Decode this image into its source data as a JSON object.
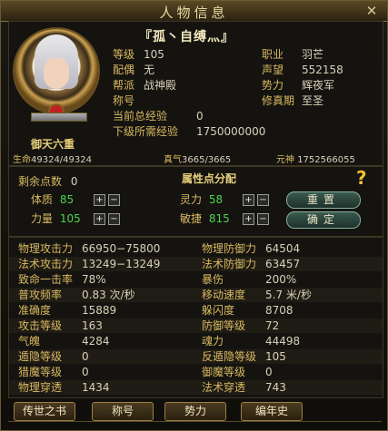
{
  "window": {
    "title": "人物信息"
  },
  "character": {
    "name": "『孤丶自缚灬』",
    "realm": "御天六重",
    "hp_label": "生命",
    "hp": "49324/49324",
    "zhenqi_label": "真气",
    "zhenqi": "3665/3665",
    "yuanshen_label": "元神",
    "yuanshen": "1752566055"
  },
  "info_left": [
    {
      "key": "等级",
      "value": "105"
    },
    {
      "key": "配偶",
      "value": "无"
    },
    {
      "key": "帮派",
      "value": "战神殿"
    },
    {
      "key": "称号",
      "value": ""
    },
    {
      "key": "当前总经验",
      "value": "0"
    },
    {
      "key": "下级所需经验",
      "value": "1750000000"
    }
  ],
  "info_right": [
    {
      "key": "职业",
      "value": "羽芒"
    },
    {
      "key": "声望",
      "value": "552158"
    },
    {
      "key": "势力",
      "value": "辉夜军"
    },
    {
      "key": "修真期",
      "value": "至圣"
    }
  ],
  "attributes": {
    "title": "属性点分配",
    "remaining_label": "剩余点数",
    "remaining": "0",
    "tizhi_label": "体质",
    "tizhi": "85",
    "liliang_label": "力量",
    "liliang": "105",
    "lingli_label": "灵力",
    "lingli": "58",
    "minjie_label": "敏捷",
    "minjie": "815",
    "reset_label": "重置",
    "confirm_label": "确定",
    "plus": "+",
    "minus": "−",
    "help": "?"
  },
  "stats": [
    [
      "物理攻击力",
      "66950−75800",
      "物理防御力",
      "64504"
    ],
    [
      "法术攻击力",
      "13249−13249",
      "法术防御力",
      "63457"
    ],
    [
      "致命一击率",
      "78%",
      "暴伤",
      "200%"
    ],
    [
      "普攻频率",
      "0.83 次/秒",
      "移动速度",
      "5.7 米/秒"
    ],
    [
      "准确度",
      "15889",
      "躲闪度",
      "8708"
    ],
    [
      "攻击等级",
      "163",
      "防御等级",
      "72"
    ],
    [
      "气魄",
      "4284",
      "魂力",
      "44498"
    ],
    [
      "遁隐等级",
      "0",
      "反遁隐等级",
      "105"
    ],
    [
      "猎魔等级",
      "0",
      "御魔等级",
      "0"
    ],
    [
      "物理穿透",
      "1434",
      "法术穿透",
      "743"
    ]
  ],
  "tabs": [
    "传世之书",
    "称号",
    "势力",
    "编年史"
  ],
  "level_progress": 1.0
}
